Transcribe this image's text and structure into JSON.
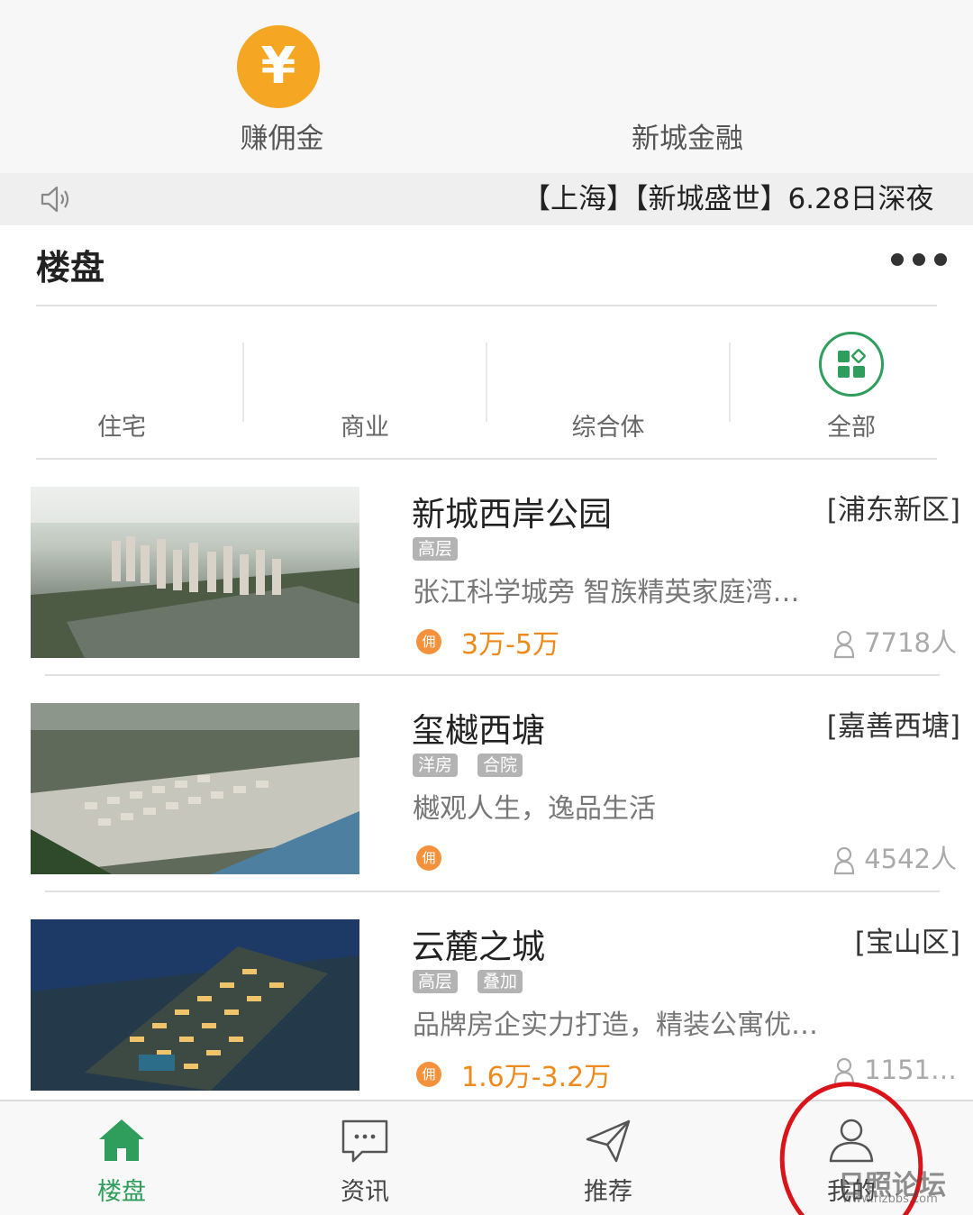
{
  "quick_entries": [
    {
      "label": "赚佣金",
      "icon": "yen-coin-icon",
      "icon_glyph": "¥"
    },
    {
      "label": "新城金融"
    }
  ],
  "marquee": {
    "text": "【上海】【新城盛世】6.28日深夜"
  },
  "section": {
    "title": "楼盘"
  },
  "categories": [
    {
      "label": "住宅"
    },
    {
      "label": "商业"
    },
    {
      "label": "综合体"
    },
    {
      "label": "全部",
      "icon": "grid-icon"
    }
  ],
  "properties": [
    {
      "name": "新城西岸公园",
      "district": "[浦东新区]",
      "tags": [
        "高层"
      ],
      "desc": "张江科学城旁 智族精英家庭湾…",
      "badge": "佣",
      "price": "3万-5万",
      "views": "7718人"
    },
    {
      "name": "玺樾西塘",
      "district": "[嘉善西塘]",
      "tags": [
        "洋房",
        "合院"
      ],
      "desc": "樾观人生，逸品生活",
      "badge": "佣",
      "price": "",
      "views": "4542人"
    },
    {
      "name": "云麓之城",
      "district": "[宝山区]",
      "tags": [
        "高层",
        "叠加"
      ],
      "desc": "品牌房企实力打造，精装公寓优…",
      "badge": "佣",
      "price": "1.6万-3.2万",
      "views": "1151…"
    }
  ],
  "tabbar": [
    {
      "label": "楼盘",
      "icon": "home-icon",
      "active": true
    },
    {
      "label": "资讯",
      "icon": "chat-icon"
    },
    {
      "label": "推荐",
      "icon": "send-icon"
    },
    {
      "label": "我的",
      "icon": "user-icon"
    }
  ],
  "watermark": {
    "text": "日照论坛",
    "url": "www.rizbbs.com"
  },
  "colors": {
    "accent": "#2f9e5c",
    "coin": "#f5a623",
    "price": "#ee8a1b",
    "annotation": "#d9141b"
  }
}
